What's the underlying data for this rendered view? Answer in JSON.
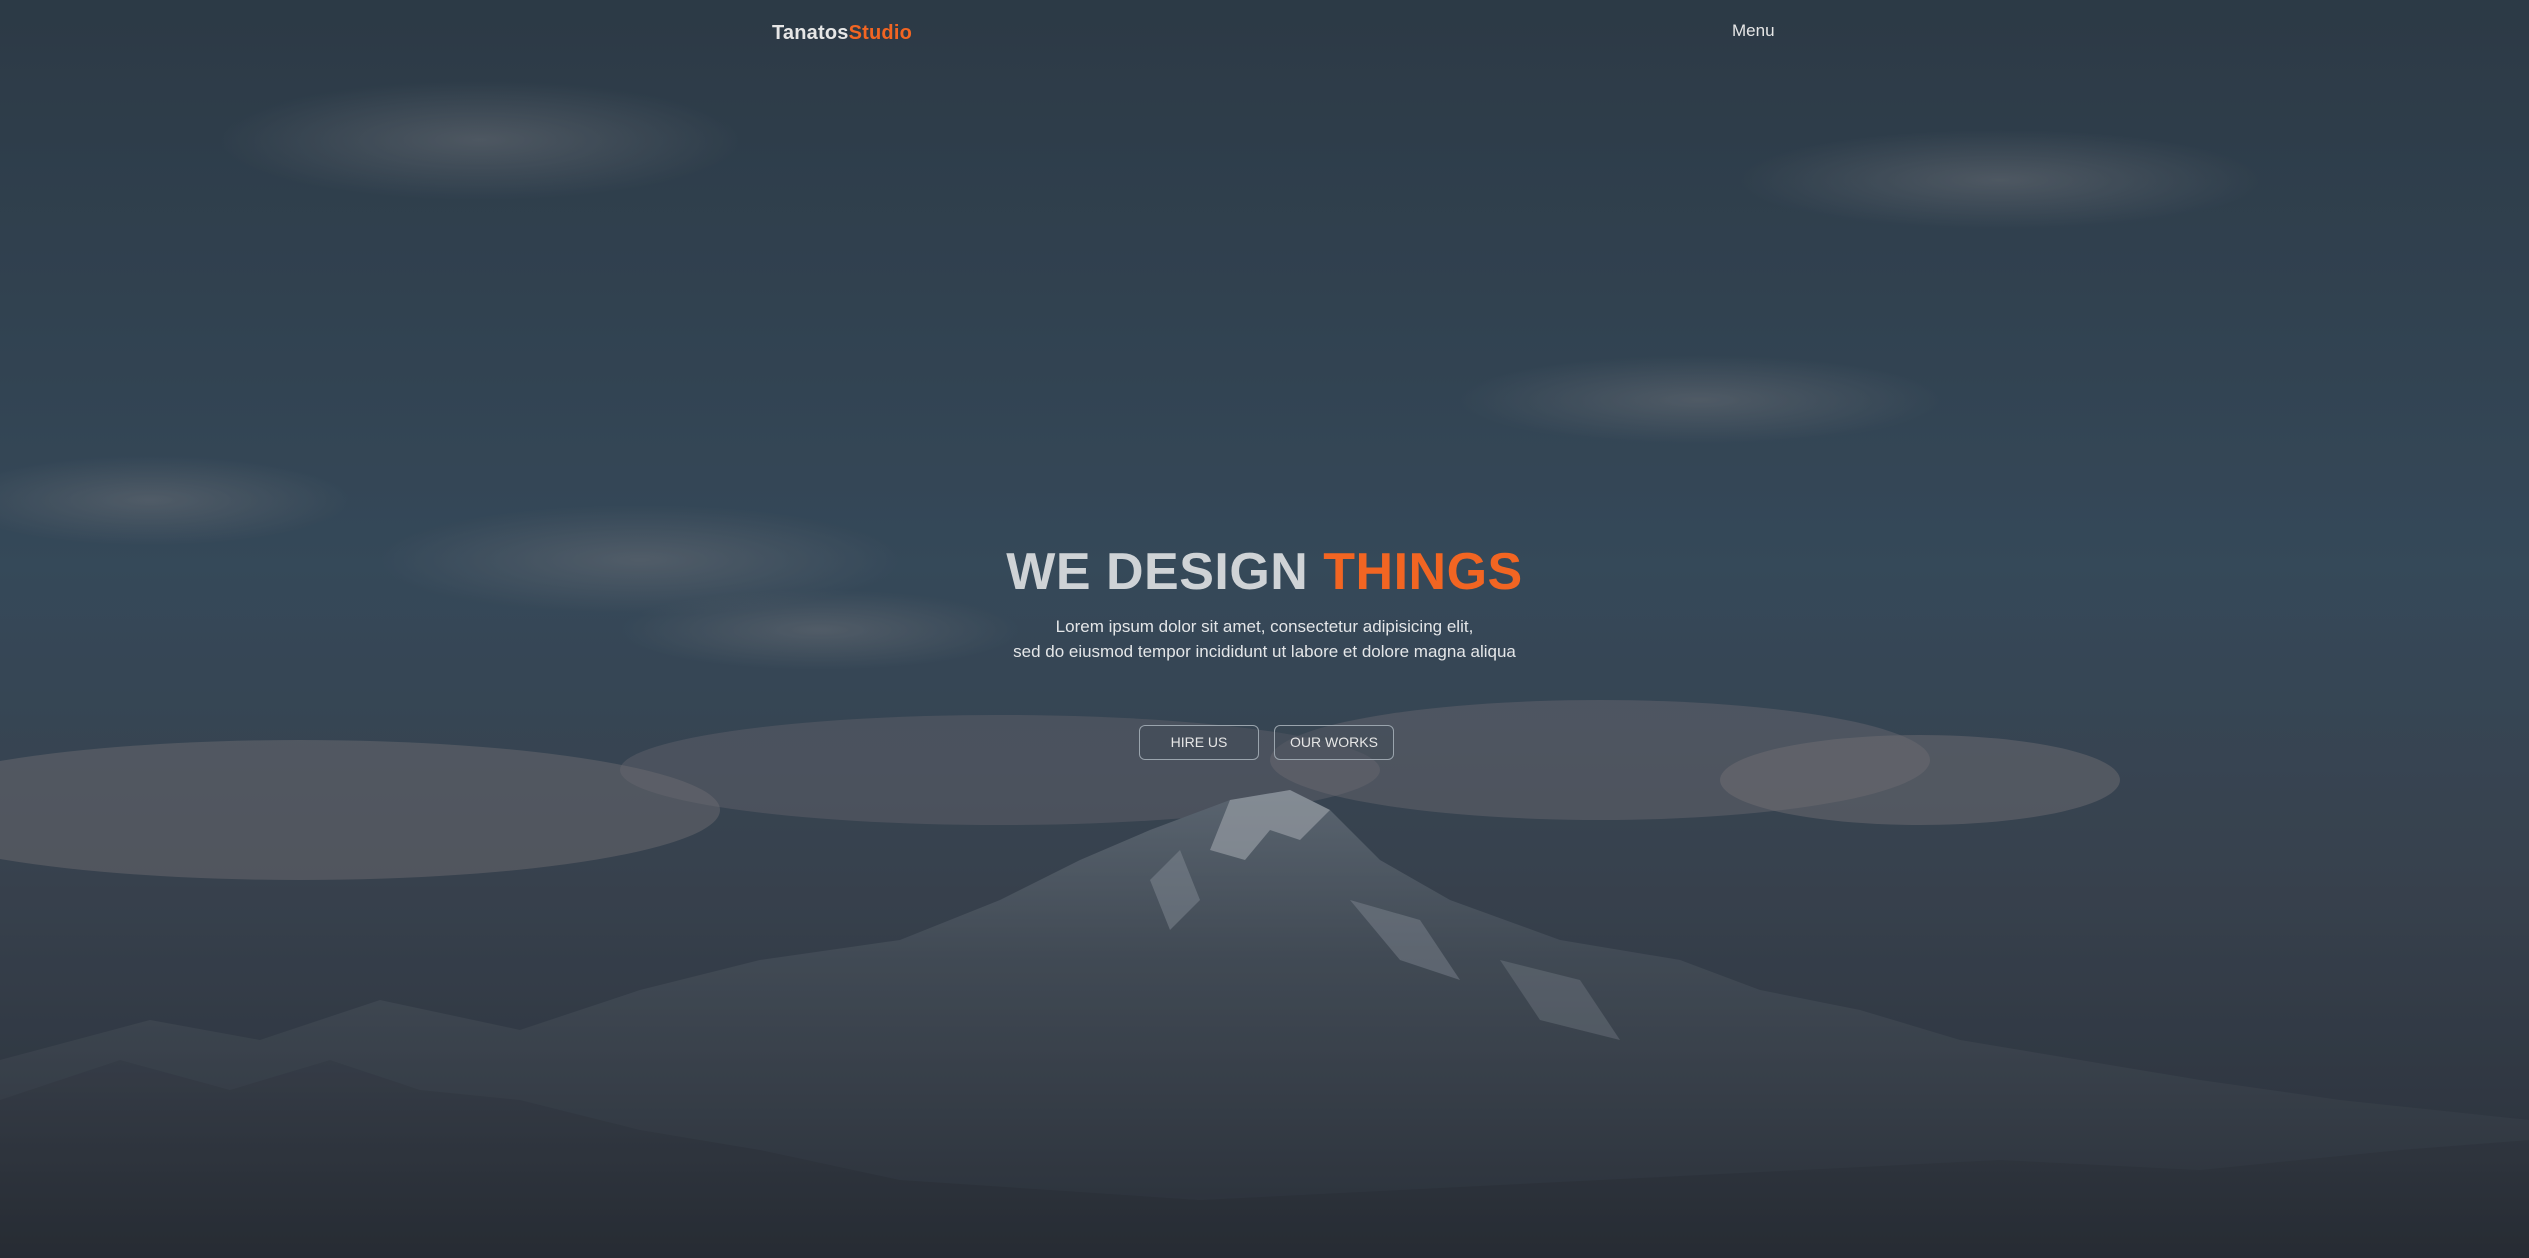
{
  "brand": {
    "name_main": "Tanatos",
    "name_accent": "Studio",
    "accent_color": "#f26522"
  },
  "nav": {
    "menu_label": "Menu"
  },
  "hero": {
    "headline_main": "WE DESIGN",
    "headline_accent": "THINGS",
    "subtext_line1": "Lorem ipsum dolor sit amet, consectetur adipisicing elit,",
    "subtext_line2": "sed do eiusmod tempor incididunt ut labore et dolore magna aliqua",
    "buttons": [
      {
        "label": "HIRE US"
      },
      {
        "label": "OUR WORKS"
      }
    ]
  },
  "background": {
    "image": "mountain-landscape-photo",
    "sky_color": "#33475a"
  }
}
